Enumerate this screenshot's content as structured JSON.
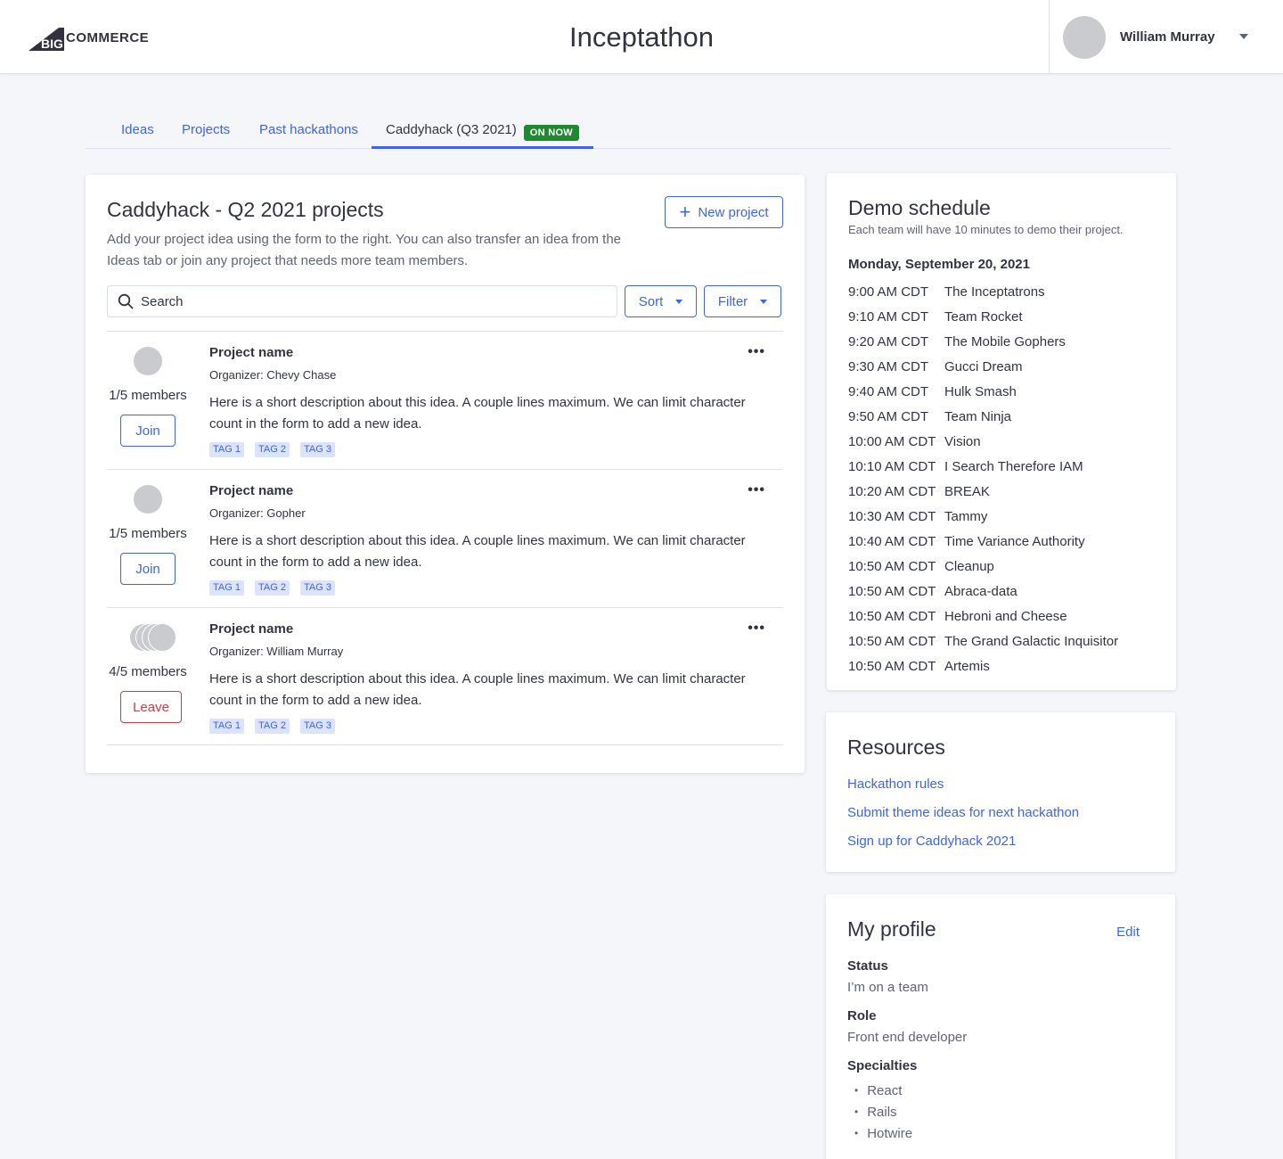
{
  "header": {
    "logo_text": "COMMERCE",
    "logo_big": "BIG",
    "app_title": "Inceptathon",
    "user_name": "William Murray"
  },
  "tabs": [
    {
      "label": "Ideas"
    },
    {
      "label": "Projects"
    },
    {
      "label": "Past hackathons"
    },
    {
      "label": "Caddyhack (Q3 2021)",
      "badge": "ON NOW",
      "active": true
    }
  ],
  "projects": {
    "title": "Caddyhack - Q2 2021 projects",
    "description": "Add your project idea using the form to the right. You can also transfer an idea from the Ideas tab or join any project that needs more team members.",
    "new_project_label": "New project",
    "search_placeholder": "Search",
    "sort_label": "Sort",
    "filter_label": "Filter",
    "items": [
      {
        "name": "Project name",
        "organizer": "Organizer: Chevy Chase",
        "members": "1/5 members",
        "description": "Here is a short description about this idea. A couple lines maximum. We can limit character count in the form to add a new idea.",
        "tags": [
          "TAG 1",
          "TAG 2",
          "TAG 3"
        ],
        "action": "Join"
      },
      {
        "name": "Project name",
        "organizer": "Organizer: Gopher",
        "members": "1/5 members",
        "description": "Here is a short description about this idea. A couple lines maximum. We can limit character count in the form to add a new idea.",
        "tags": [
          "TAG 1",
          "TAG 2",
          "TAG 3"
        ],
        "action": "Join"
      },
      {
        "name": "Project name",
        "organizer": "Organizer: William Murray",
        "members": "4/5 members",
        "description": "Here is a short description about this idea. A couple lines maximum. We can limit character count in the form to add a new idea.",
        "tags": [
          "TAG 1",
          "TAG 2",
          "TAG 3"
        ],
        "action": "Leave"
      }
    ]
  },
  "demo": {
    "title": "Demo schedule",
    "subtitle": "Each team will have 10 minutes to demo their project.",
    "date": "Monday, September 20, 2021",
    "schedule": [
      {
        "time": "9:00 AM CDT",
        "team": "The Inceptatrons"
      },
      {
        "time": "9:10 AM CDT",
        "team": "Team Rocket"
      },
      {
        "time": "9:20 AM CDT",
        "team": "The Mobile Gophers"
      },
      {
        "time": "9:30 AM CDT",
        "team": "Gucci Dream"
      },
      {
        "time": "9:40 AM CDT",
        "team": "Hulk Smash"
      },
      {
        "time": "9:50 AM CDT",
        "team": "Team Ninja"
      },
      {
        "time": "10:00 AM CDT",
        "team": "Vision"
      },
      {
        "time": "10:10 AM CDT",
        "team": "I Search Therefore IAM"
      },
      {
        "time": "10:20 AM CDT",
        "team": "BREAK"
      },
      {
        "time": "10:30 AM CDT",
        "team": "Tammy"
      },
      {
        "time": "10:40 AM CDT",
        "team": "Time Variance Authority"
      },
      {
        "time": "10:50 AM CDT",
        "team": "Cleanup"
      },
      {
        "time": "10:50 AM CDT",
        "team": "Abraca-data"
      },
      {
        "time": "10:50 AM CDT",
        "team": "Hebroni and Cheese"
      },
      {
        "time": "10:50 AM CDT",
        "team": "The Grand Galactic Inquisitor"
      },
      {
        "time": "10:50 AM CDT",
        "team": "Artemis"
      }
    ]
  },
  "resources": {
    "title": "Resources",
    "links": [
      "Hackathon rules",
      "Submit theme ideas for next hackathon",
      "Sign up for Caddyhack 2021"
    ]
  },
  "profile": {
    "title": "My profile",
    "edit_label": "Edit",
    "status_label": "Status",
    "status_value": "I’m on a team",
    "role_label": "Role",
    "role_value": "Front end developer",
    "specialties_label": "Specialties",
    "specialties": [
      "React",
      "Rails",
      "Hotwire"
    ]
  },
  "colors": {
    "accent": "#3c64f4",
    "danger": "#db3643",
    "success_badge": "#208831",
    "tag_bg": "#dbe3fe"
  }
}
